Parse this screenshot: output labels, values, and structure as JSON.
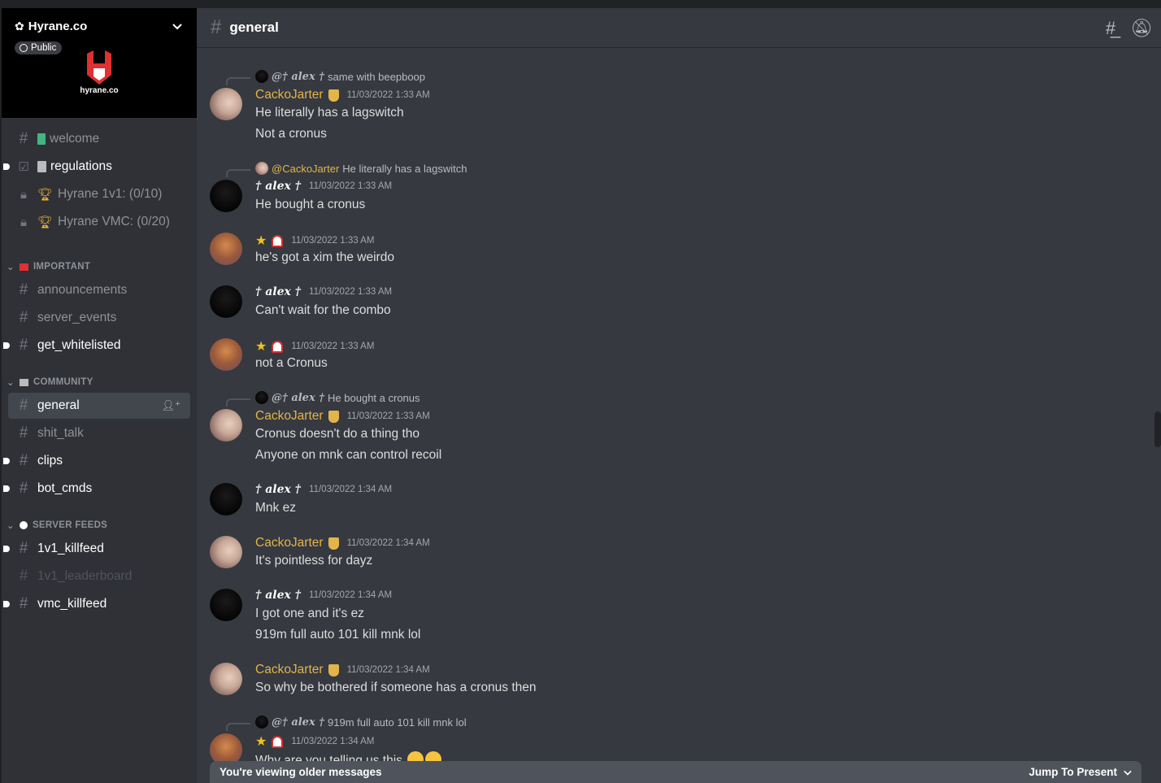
{
  "server": {
    "name": "Hyrane.co",
    "public_label": "Public",
    "logo_text": "hyrane.co"
  },
  "sidebar": {
    "channels_top": [
      {
        "label": "welcome",
        "state": "read",
        "type": "text-emoji-green"
      },
      {
        "label": "regulations",
        "state": "unread",
        "type": "rules"
      },
      {
        "label": "Hyrane 1v1: (0/10)",
        "state": "read",
        "type": "locked-trophy"
      },
      {
        "label": "Hyrane VMC: (0/20)",
        "state": "read",
        "type": "locked-trophy"
      }
    ],
    "categories": [
      {
        "label": "IMPORTANT",
        "channels": [
          {
            "label": "announcements",
            "state": "read"
          },
          {
            "label": "server_events",
            "state": "read"
          },
          {
            "label": "get_whitelisted",
            "state": "unread"
          }
        ]
      },
      {
        "label": "COMMUNITY",
        "channels": [
          {
            "label": "general",
            "state": "active"
          },
          {
            "label": "shit_talk",
            "state": "read"
          },
          {
            "label": "clips",
            "state": "unread"
          },
          {
            "label": "bot_cmds",
            "state": "unread"
          }
        ]
      },
      {
        "label": "SERVER FEEDS",
        "channels": [
          {
            "label": "1v1_killfeed",
            "state": "unread"
          },
          {
            "label": "1v1_leaderboard",
            "state": "muted"
          },
          {
            "label": "vmc_killfeed",
            "state": "unread"
          }
        ]
      }
    ]
  },
  "header": {
    "channel_name": "general",
    "icons": [
      "threads-icon",
      "notifications-muted-icon"
    ]
  },
  "messages": [
    {
      "reply_to": "@† alex †",
      "reply_text": "same with beepboop",
      "author": "CackoJarter",
      "author_style": "cacko",
      "timestamp": "11/03/2022 1:33 AM",
      "lines": [
        "He literally has a lagswitch",
        "Not a cronus"
      ]
    },
    {
      "reply_to": "@CackoJarter",
      "reply_text": "He literally has a lagswitch",
      "author": "† alex †",
      "author_style": "alex",
      "timestamp": "11/03/2022 1:33 AM",
      "lines": [
        "He bought a cronus"
      ]
    },
    {
      "author": "★ ☠",
      "author_style": "star",
      "timestamp": "11/03/2022 1:33 AM",
      "lines": [
        "he's got a xim the weirdo"
      ]
    },
    {
      "author": "† alex †",
      "author_style": "alex",
      "timestamp": "11/03/2022 1:33 AM",
      "lines": [
        "Can't wait for the combo"
      ]
    },
    {
      "author": "★ ☠",
      "author_style": "star",
      "timestamp": "11/03/2022 1:33 AM",
      "lines": [
        "not a Cronus"
      ]
    },
    {
      "reply_to": "@† alex †",
      "reply_text": "He bought a cronus",
      "author": "CackoJarter",
      "author_style": "cacko",
      "timestamp": "11/03/2022 1:33 AM",
      "lines": [
        "Cronus doesn't do a thing tho",
        "Anyone on mnk can control recoil"
      ]
    },
    {
      "author": "† alex †",
      "author_style": "alex",
      "timestamp": "11/03/2022 1:34 AM",
      "lines": [
        "Mnk ez"
      ]
    },
    {
      "author": "CackoJarter",
      "author_style": "cacko",
      "timestamp": "11/03/2022 1:34 AM",
      "lines": [
        "It's pointless for dayz"
      ]
    },
    {
      "author": "† alex †",
      "author_style": "alex",
      "timestamp": "11/03/2022 1:34 AM",
      "lines": [
        "I got one and it's ez",
        "919m full auto 101 kill mnk lol"
      ]
    },
    {
      "author": "CackoJarter",
      "author_style": "cacko",
      "timestamp": "11/03/2022 1:34 AM",
      "lines": [
        "So why be bothered if someone has a cronus then"
      ]
    },
    {
      "reply_to": "@† alex †",
      "reply_text": "919m full auto 101 kill mnk lol",
      "author": "★ ☠",
      "author_style": "star",
      "timestamp": "11/03/2022 1:34 AM",
      "lines": [
        "Why are you telling us this"
      ]
    }
  ],
  "older_bar": {
    "label": "You're viewing older messages",
    "jump_label": "Jump To Present"
  },
  "colors": {
    "accent_gold": "#e3b44b",
    "bg_main": "#36393f",
    "bg_sidebar": "#2f3136"
  }
}
